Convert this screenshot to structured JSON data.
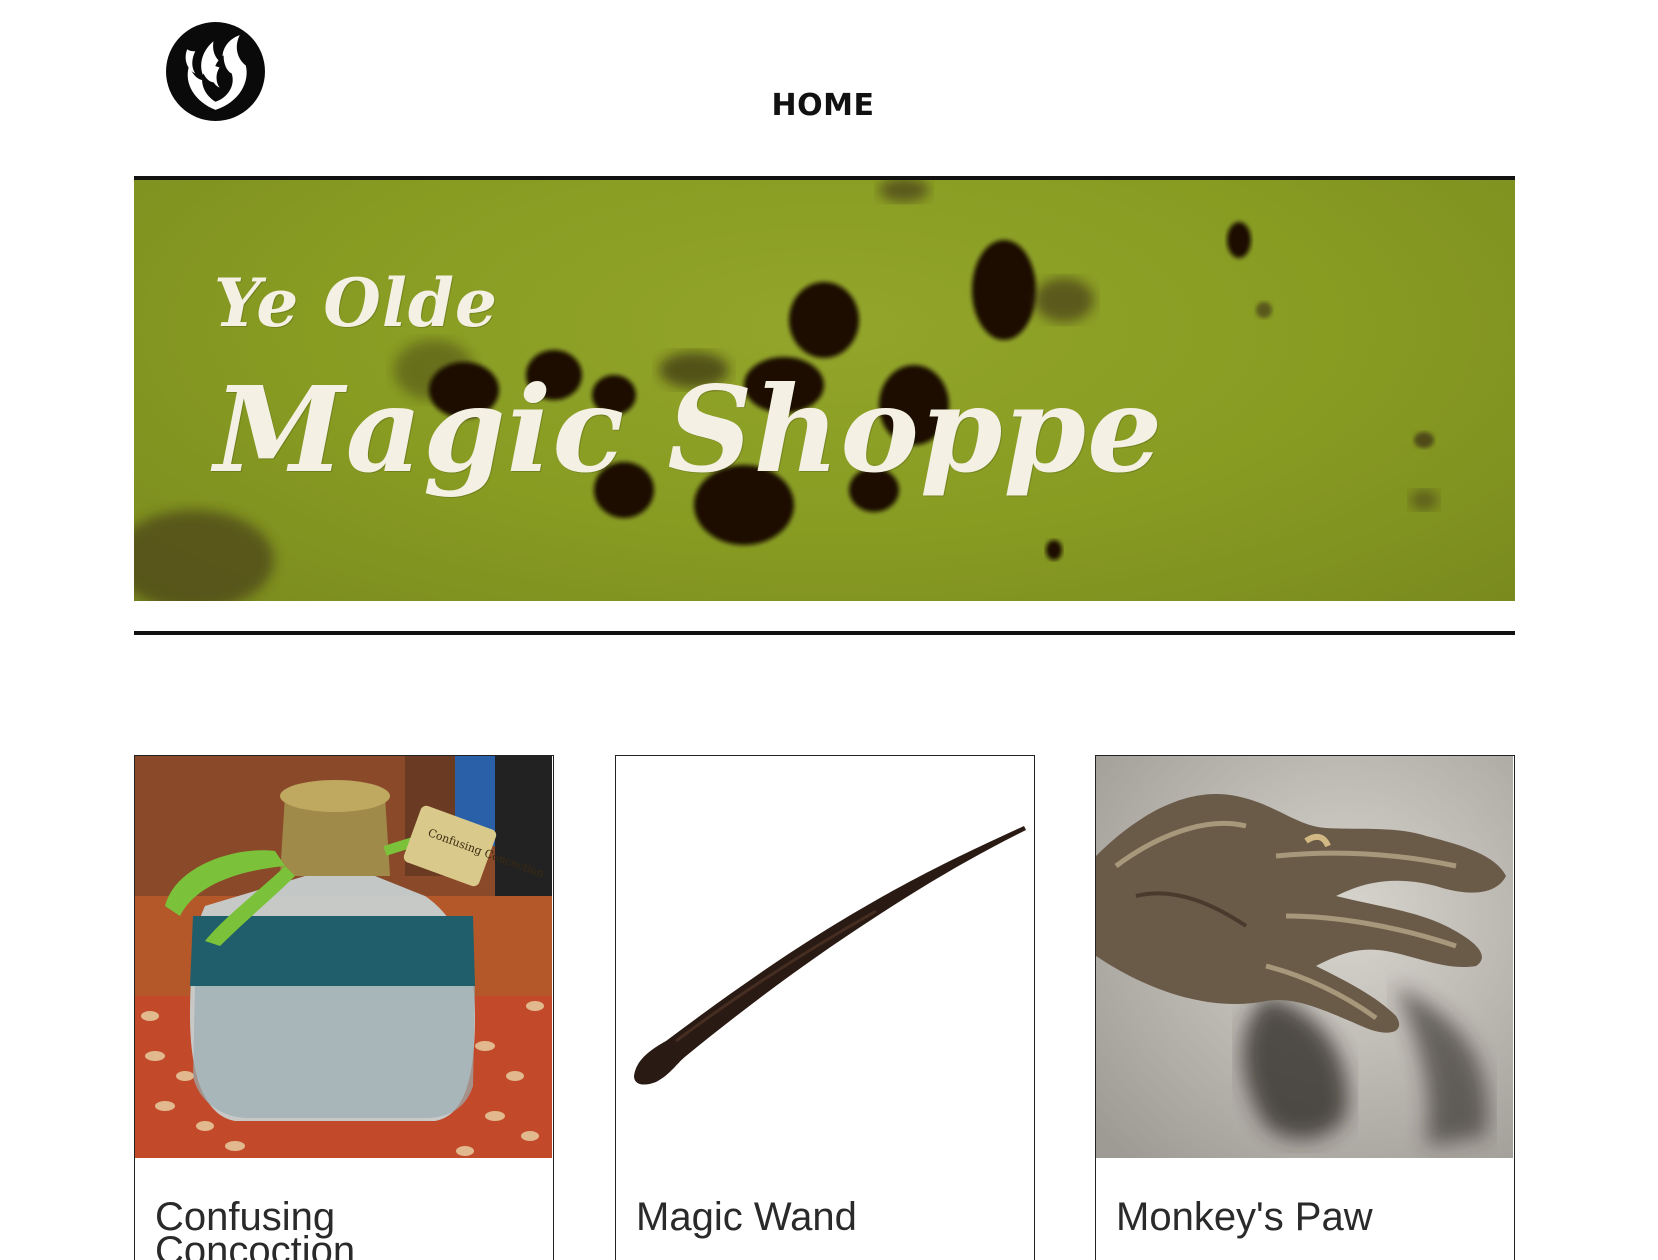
{
  "header": {
    "logo_icon": "flame-emblem-icon",
    "nav": [
      {
        "label": "HOME"
      }
    ]
  },
  "hero": {
    "title_small": "Ye Olde",
    "title_large": "Magic Shoppe",
    "background_color": "#879b22",
    "text_color": "#f4f1e4"
  },
  "products": [
    {
      "name": "Confusing Concoction",
      "image": "potion-bottle-image",
      "tag_text": "Confusing Concoction"
    },
    {
      "name": "Magic Wand",
      "image": "magic-wand-image"
    },
    {
      "name": "Monkey's Paw",
      "image": "monkey-paw-image"
    }
  ]
}
